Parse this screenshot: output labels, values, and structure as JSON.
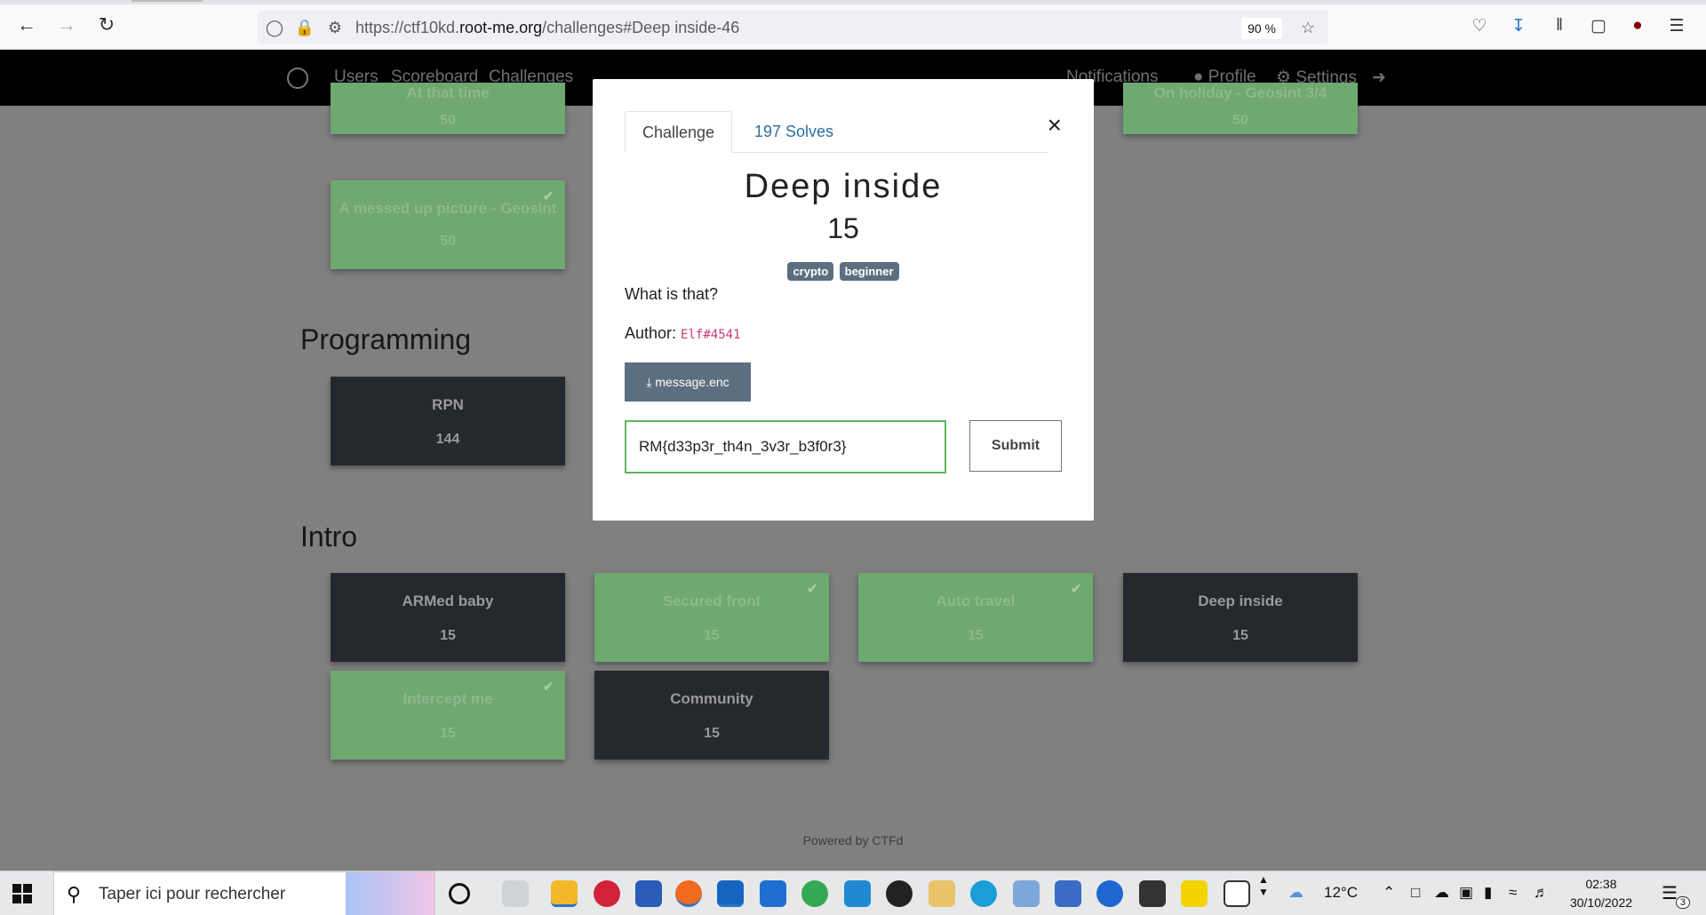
{
  "browser": {
    "url_prefix": "https://ctf10kd.",
    "url_domain": "root-me.org",
    "url_suffix": "/challenges#Deep inside-46",
    "zoom": "90 %"
  },
  "nav": {
    "users": "Users",
    "scoreboard": "Scoreboard",
    "challenges": "Challenges",
    "notifications": "Notifications",
    "profile": "Profile",
    "settings": "Settings"
  },
  "sections": {
    "programming": "Programming",
    "intro": "Intro"
  },
  "cards": {
    "at_that_time": {
      "name": "At that time",
      "value": "50"
    },
    "messed_up": {
      "name": "A messed up picture - Geosint",
      "value": "50"
    },
    "on_holiday": {
      "name": "On holiday - Geosint 3/4",
      "value": "50"
    },
    "rpn": {
      "name": "RPN",
      "value": "144"
    },
    "armed_baby": {
      "name": "ARMed baby",
      "value": "15"
    },
    "secured_front": {
      "name": "Secured front",
      "value": "15"
    },
    "auto_travel": {
      "name": "Auto travel",
      "value": "15"
    },
    "deep_inside": {
      "name": "Deep inside",
      "value": "15"
    },
    "intercept_me": {
      "name": "Intercept me",
      "value": "15"
    },
    "community": {
      "name": "Community",
      "value": "15"
    }
  },
  "footer": "Powered by CTFd",
  "modal": {
    "tab_challenge": "Challenge",
    "tab_solves": "197 Solves",
    "close": "×",
    "title": "Deep inside",
    "value": "15",
    "tags": [
      "crypto",
      "beginner"
    ],
    "description": "What is that?",
    "author_label": "Author: ",
    "author_name": "Elf#4541",
    "file_label": "message.enc",
    "flag_value": "RM{d33p3r_th4n_3v3r_b3f0r3}",
    "submit_label": "Submit"
  },
  "taskbar": {
    "search_placeholder": "Taper ici pour rechercher",
    "weather": "12°C",
    "time": "02:38",
    "date": "30/10/2022",
    "notification_count": "3"
  },
  "colors": {
    "solved_card": "#6fa870",
    "unsolved_card": "#25282c",
    "tag_bg": "#5c6f80",
    "input_border": "#5cb85c",
    "link": "#2c6ea4"
  }
}
